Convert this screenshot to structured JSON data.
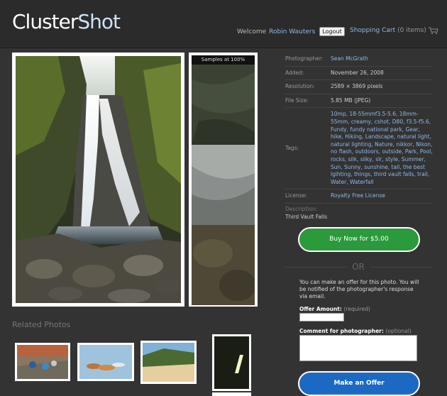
{
  "header": {
    "logo_part1": "Cluster",
    "logo_part2": "Shot",
    "welcome": "Welcome",
    "user": "Robin Wauters",
    "logout": "Logout",
    "cart_label": "Shopping Cart",
    "cart_count": "(0 items)"
  },
  "samples": {
    "caption": "Samples at 100%"
  },
  "details": {
    "photographer_k": "Photographer:",
    "photographer_v": "Sean McGrath",
    "added_k": "Added:",
    "added_v": "November 26, 2008",
    "resolution_k": "Resolution:",
    "resolution_v": "2589 × 3869 pixels",
    "filesize_k": "File Size:",
    "filesize_v": "5.85 MB (JPEG)",
    "tags_k": "Tags:",
    "tags_v": "10mp, 18-55mmf3.5-5.6, 18mm-55mm, creamy, cshot, D80, f3.5-f5.6, Fundy, fundy national park, Gear, hike, Hiking, Landscape, natural light, natural lighting, Nature, nikkor, Nikon, no flash, outdoors, outside, Park, Pool, rocks, silk, silky, slr, style, Summer, Sun, Sunny, sunshine, tall, the best lgihting, things, third vault falls, trail, Water, Waterfall",
    "license_k": "License:",
    "license_v": "Royalty Free License",
    "description_k": "Description:",
    "description_v": "Third Vault Falls"
  },
  "purchase": {
    "buy_label": "Buy Now for $5.00",
    "or": "OR",
    "offer_text": "You can make an offer for this photo. You will be notified of the photographer's response via email.",
    "amount_label": "Offer Amount:",
    "amount_req": "(required)",
    "comment_label": "Comment for photographer:",
    "comment_opt": "(optional)",
    "offer_button": "Make an Offer"
  },
  "related": {
    "title": "Related Photos"
  },
  "colors": {
    "background": "#333333",
    "link": "#8fb8e8",
    "buy": "#2a9a3c",
    "offer": "#1c69c4"
  }
}
